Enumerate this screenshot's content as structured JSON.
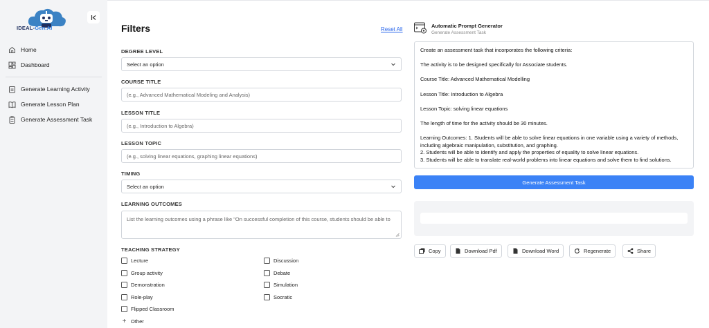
{
  "sidebar": {
    "logo_text": "IDEAL-",
    "logo_text_ai": "Gen.AI",
    "collapse_icon": "collapse-left-icon",
    "nav_primary": [
      {
        "label": "Home",
        "icon": "home-icon"
      },
      {
        "label": "Dashboard",
        "icon": "dashboard-icon"
      }
    ],
    "nav_secondary": [
      {
        "label": "Generate Learning Activity",
        "icon": "clipboard-icon"
      },
      {
        "label": "Generate Lesson Plan",
        "icon": "book-icon"
      },
      {
        "label": "Generate Assessment Task",
        "icon": "checklist-icon"
      }
    ]
  },
  "filters": {
    "title": "Filters",
    "reset_label": "Reset All",
    "degree_level": {
      "label": "DEGREE LEVEL",
      "value": "Select an option"
    },
    "course_title": {
      "label": "COURSE TITLE",
      "placeholder": "(e.g., Advanced Mathematical Modeling and Analysis)"
    },
    "lesson_title": {
      "label": "LESSON TITLE",
      "placeholder": "(e.g., Introduction to Algebra)"
    },
    "lesson_topic": {
      "label": "LESSON TOPIC",
      "placeholder": "(e.g., solving linear equations, graphing linear equations)"
    },
    "timing": {
      "label": "TIMING",
      "value": "Select an option"
    },
    "learning_outcomes": {
      "label": "LEARNING OUTCOMES",
      "placeholder": "List the learning outcomes using a phrase like \"On successful completion of this course, students should be able to"
    },
    "teaching_strategy": {
      "label": "TEACHING STRATEGY",
      "options_left": [
        "Lecture",
        "Group activity",
        "Demonstration",
        "Role-play",
        "Flipped Classroom"
      ],
      "options_right": [
        "Discussion",
        "Debate",
        "Simulation",
        "Socratic"
      ],
      "other_label": "Other"
    }
  },
  "generator": {
    "title": "Automatic Prompt Generator",
    "subtitle": "Generate Assessment Task",
    "prompt_text": "Create an assessment task that incorporates the following criteria:\n\nThe activity is to be designed specifically for Associate students.\n\nCourse Title: Advanced Mathematical Modelling\n\nLesson Title: Introduction to Algebra\n\nLesson Topic: solving linear equations\n\nThe length of time for the activity should be 30 minutes.\n\nLearning Outcomes: 1. Students will be able to solve linear equations in one variable using a variety of methods, including algebraic manipulation, substitution, and graphing.\n2. Students will be able to identify and apply the properties of equality to solve linear equations.\n3. Students will be able to translate real-world problems into linear equations and solve them to find solutions.",
    "generate_button": "Generate Assessment Task",
    "actions": [
      {
        "label": "Copy",
        "icon": "copy-icon"
      },
      {
        "label": "Download Pdf",
        "icon": "file-icon"
      },
      {
        "label": "Download Word",
        "icon": "file-icon"
      },
      {
        "label": "Regenerate",
        "icon": "refresh-icon"
      },
      {
        "label": "Share",
        "icon": "share-icon"
      }
    ]
  },
  "colors": {
    "accent": "#3b82f6",
    "link": "#2563eb",
    "sidebar_bg": "#f3f4f6",
    "logo_navy": "#1f2f5f"
  }
}
